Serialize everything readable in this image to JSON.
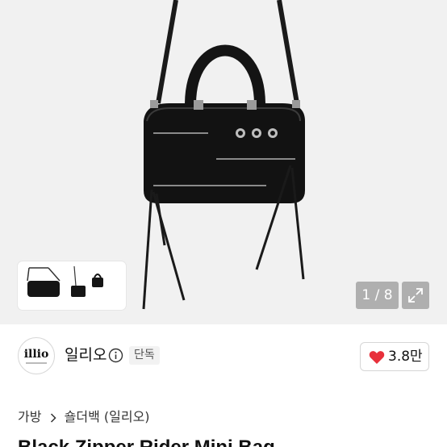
{
  "gallery": {
    "counter": "1 / 8",
    "expand_icon": "expand-arrows-icon"
  },
  "seller": {
    "avatar_text": "illio",
    "name": "일리오",
    "info_icon": "info-circle-icon",
    "badge": "단독"
  },
  "like": {
    "icon": "heart-icon",
    "count": "3.8만",
    "heart_color": "#e8303b"
  },
  "breadcrumb": {
    "items": [
      "가방",
      "숄더백 (일리오)"
    ],
    "separator_icon": "chevron-right-icon"
  },
  "product": {
    "title": "Black Zipper Rider Mini Bag"
  }
}
